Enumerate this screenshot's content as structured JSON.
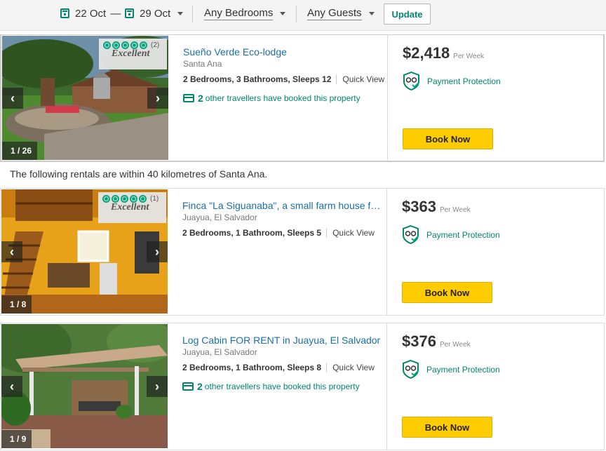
{
  "filters": {
    "checkin": "22 Oct",
    "separator": "—",
    "checkout": "29 Oct",
    "bedrooms": "Any Bedrooms",
    "guests": "Any Guests",
    "update_label": "Update"
  },
  "note": "The following rentals are within 40 kilometres of Santa Ana.",
  "listings": [
    {
      "title": "Sueño Verde Eco-lodge",
      "location": "Santa Ana",
      "specs": "2 Bedrooms, 3 Bathrooms, Sleeps 12",
      "quick_view": "Quick View",
      "booked_count": "2",
      "booked_text": "other travellers have booked this property",
      "price": "$2,418",
      "per": "Per Week",
      "protection": "Payment Protection",
      "book_label": "Book Now",
      "photo_counter": "1 / 26",
      "rating_count": "(2)",
      "rating_text": "Excellent"
    },
    {
      "title": "Finca \"La Siguanaba\", a small farm house for rent in Juayua",
      "location": "Juayua, El Salvador",
      "specs": "2 Bedrooms, 1 Bathroom, Sleeps 5",
      "quick_view": "Quick View",
      "price": "$363",
      "per": "Per Week",
      "protection": "Payment Protection",
      "book_label": "Book Now",
      "photo_counter": "1 / 8",
      "rating_count": "(1)",
      "rating_text": "Excellent"
    },
    {
      "title": "Log Cabin FOR RENT in Juayua, El Salvador",
      "location": "Juayua, El Salvador",
      "specs": "2 Bedrooms, 1 Bathroom, Sleeps 8",
      "quick_view": "Quick View",
      "booked_count": "2",
      "booked_text": "other travellers have booked this property",
      "price": "$376",
      "per": "Per Week",
      "protection": "Payment Protection",
      "book_label": "Book Now",
      "photo_counter": "1 / 9"
    }
  ],
  "icons": {
    "calendar": "calendar-icon",
    "caret": "chevron-down-icon",
    "arrow_left": "chevron-left-icon",
    "arrow_right": "chevron-right-icon",
    "shield": "payment-protection-icon",
    "card": "credit-card-icon",
    "bubble": "rating-bubble-icon"
  },
  "colors": {
    "accent_green": "#00876c",
    "link_blue": "#1a6fa3",
    "book_yellow": "#ffcc00"
  }
}
